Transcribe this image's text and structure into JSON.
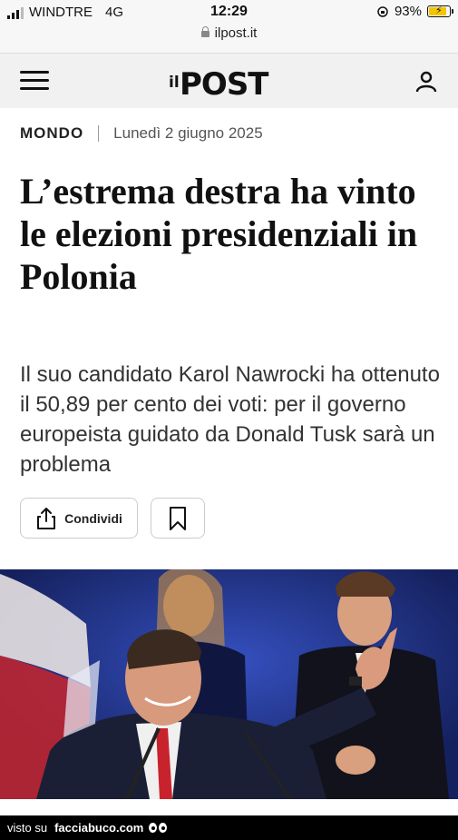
{
  "status_bar": {
    "carrier": "WINDTRE",
    "network": "4G",
    "time": "12:29",
    "url": "ilpost.it",
    "battery": "93%"
  },
  "header": {
    "logo_small": "il",
    "logo_main": "POST",
    "menu_icon": "hamburger-icon",
    "user_icon": "user-icon"
  },
  "article": {
    "section": "MONDO",
    "date": "Lunedì 2 giugno 2025",
    "title": "L’estrema destra ha vinto le elezioni presidenziali in Polonia",
    "subtitle": "Il suo candidato Karol Nawrocki ha ottenuto il 50,89 per cento dei voti: per il governo europeista guidato da Donald Tusk sarà un problema",
    "share_label": "Condividi"
  },
  "footer": {
    "prefix": "visto su",
    "brand": "facciabuco.com"
  },
  "colors": {
    "header_bg": "#f1f1f1",
    "photo_blue": "#243a9c",
    "battery": "#f5c400"
  }
}
